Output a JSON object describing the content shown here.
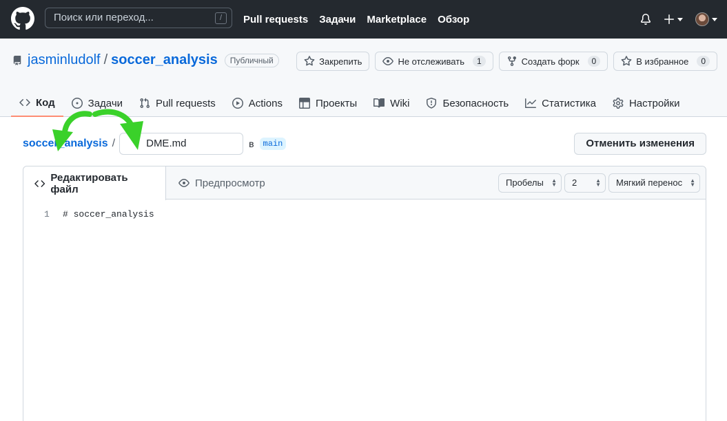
{
  "header": {
    "search_placeholder": "Поиск или переход...",
    "search_shortcut": "/",
    "nav": [
      "Pull requests",
      "Задачи",
      "Marketplace",
      "Обзор"
    ]
  },
  "repo": {
    "owner": "jasminludolf",
    "separator": "/",
    "name": "soccer_analysis",
    "visibility": "Публичный",
    "buttons": {
      "pin": "Закрепить",
      "unwatch": "Не отслеживать",
      "unwatch_count": "1",
      "fork": "Создать форк",
      "fork_count": "0",
      "star": "В избранное",
      "star_count": "0"
    },
    "tabs": [
      "Код",
      "Задачи",
      "Pull requests",
      "Actions",
      "Проекты",
      "Wiki",
      "Безопасность",
      "Статистика",
      "Настройки"
    ]
  },
  "breadcrumb": {
    "repo": "soccer_analysis",
    "slash": "/",
    "filename": "DME.md",
    "in_label": "в",
    "branch": "main"
  },
  "cancel_label": "Отменить изменения",
  "editor": {
    "tab_edit": "Редактировать файл",
    "tab_preview": "Предпросмотр",
    "indent_mode": "Пробелы",
    "indent_size": "2",
    "wrap_mode": "Мягкий перенос",
    "lines": [
      {
        "no": "1",
        "text": "# soccer_analysis"
      }
    ]
  },
  "colors": {
    "header_bg": "#24292f",
    "link": "#0969da",
    "active_tab_underline": "#fd8c73",
    "arrow": "#3ad12a"
  }
}
